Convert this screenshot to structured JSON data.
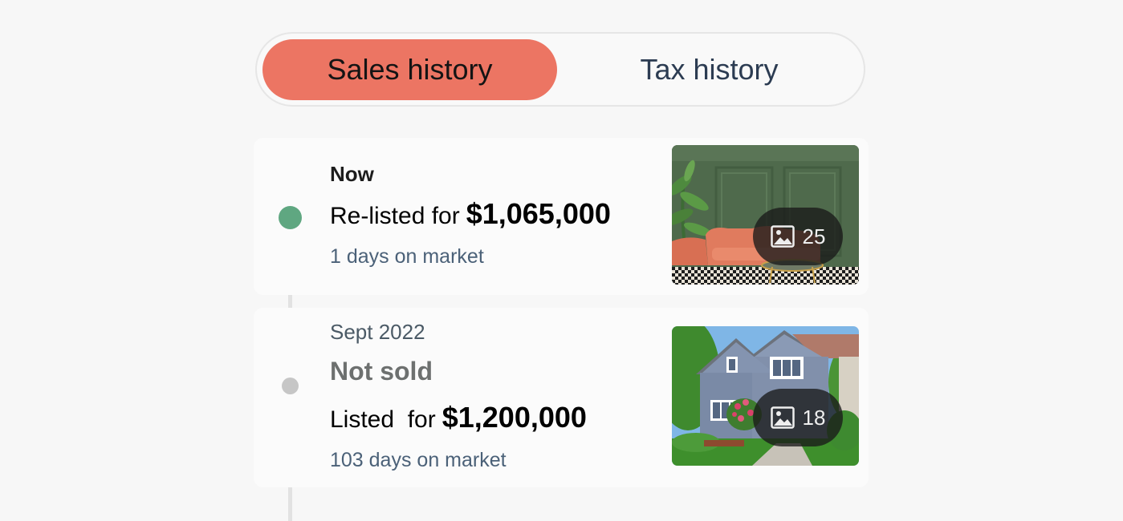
{
  "tabs": {
    "sales_label": "Sales history",
    "tax_label": "Tax history",
    "active": "Sales history"
  },
  "events": [
    {
      "date": "Now",
      "action": "Re-listed for",
      "price": "$1,065,000",
      "days_on_market": "1 days on market",
      "photo_count": "25",
      "thumbnail": "interior-living-room-photo",
      "dot_color": "#5fa781"
    },
    {
      "date": "Sept 2022",
      "status": "Not sold",
      "action": "Listed  for",
      "price": "$1,200,000",
      "days_on_market": "103 days on market",
      "photo_count": "18",
      "thumbnail": "house-exterior-photo",
      "dot_color": "#c6c6c6"
    }
  ],
  "icons": {
    "photo_badge": "image-icon"
  },
  "colors": {
    "accent": "#ec7563",
    "current_dot": "#5fa781",
    "past_dot": "#c6c6c6",
    "muted_text": "#4b6178"
  }
}
